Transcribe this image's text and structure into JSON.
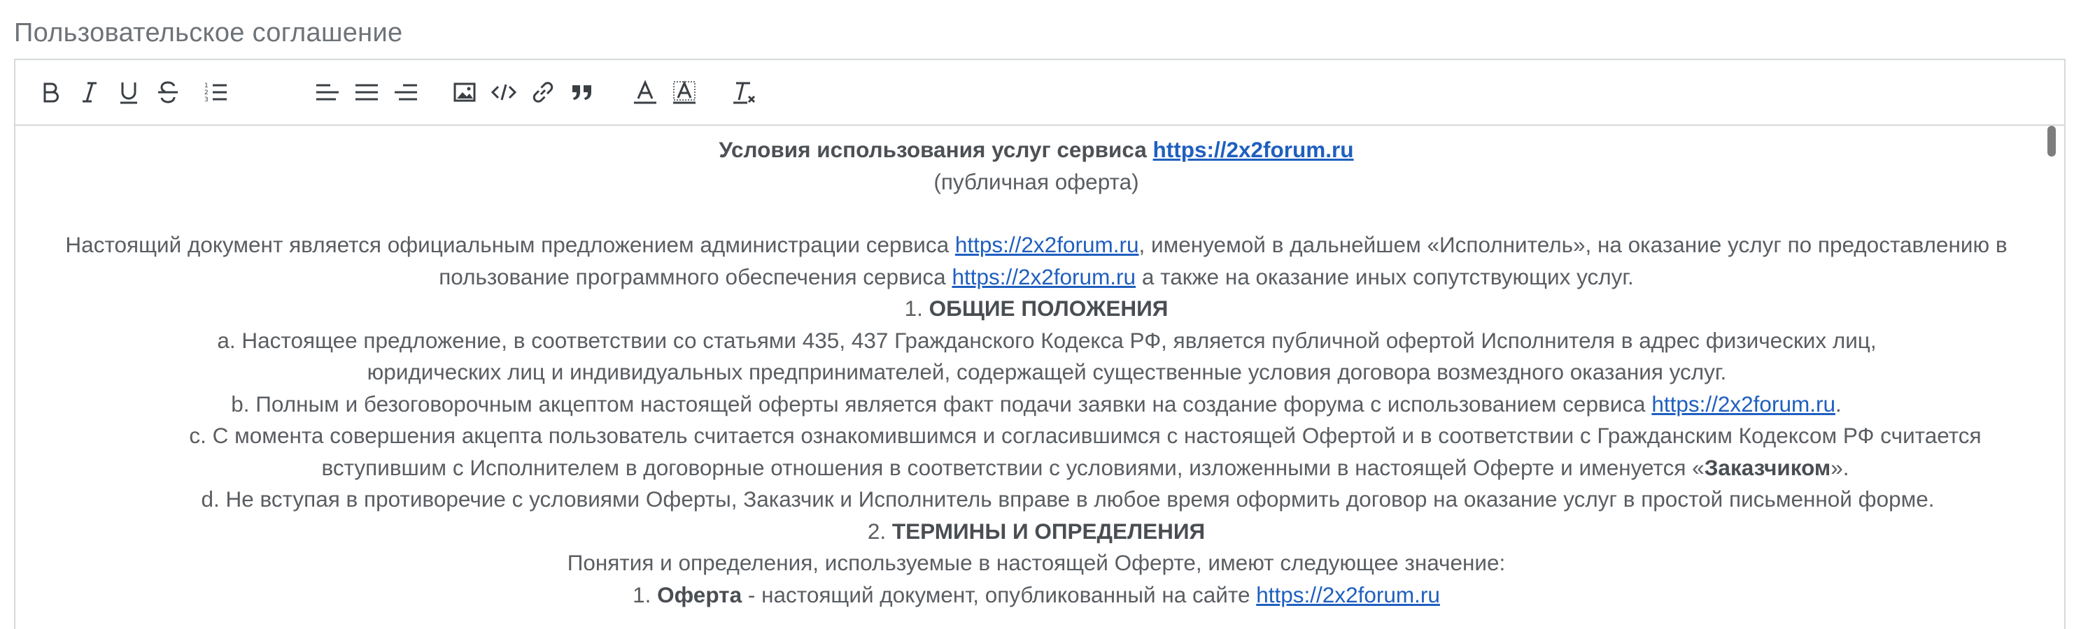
{
  "field": {
    "label": "Пользовательское соглашение"
  },
  "toolbar": {
    "buttons": [
      {
        "name": "bold-button",
        "icon": "bold-icon"
      },
      {
        "name": "italic-button",
        "icon": "italic-icon"
      },
      {
        "name": "underline-button",
        "icon": "underline-icon"
      },
      {
        "name": "strikethrough-button",
        "icon": "strikethrough-icon"
      },
      {
        "name": "ordered-list-button",
        "icon": "ordered-list-icon"
      },
      {
        "name": "align-left-button",
        "icon": "align-left-icon"
      },
      {
        "name": "align-center-button",
        "icon": "align-center-icon"
      },
      {
        "name": "align-right-button",
        "icon": "align-right-icon"
      },
      {
        "name": "insert-image-button",
        "icon": "image-icon"
      },
      {
        "name": "code-button",
        "icon": "code-icon"
      },
      {
        "name": "insert-link-button",
        "icon": "link-icon"
      },
      {
        "name": "blockquote-button",
        "icon": "quote-icon"
      },
      {
        "name": "font-color-button",
        "icon": "font-color-icon"
      },
      {
        "name": "background-color-button",
        "icon": "highlight-icon"
      },
      {
        "name": "clear-format-button",
        "icon": "clear-format-icon"
      }
    ]
  },
  "doc": {
    "link": "https://2x2forum.ru",
    "title": "Условия использования услуг сервиса",
    "subtitle": "(публичная оферта)",
    "intro_1": "Настоящий документ является официальным предложением администрации сервиса",
    "intro_2": ", именуемой в дальнейшем «Исполнитель», на оказание услуг по предоставлению в пользование программного обеспечения сервиса",
    "intro_3": "а также на оказание иных сопутствующих услуг.",
    "s1_num": "1.",
    "s1_title": "ОБЩИЕ ПОЛОЖЕНИЯ",
    "s1_a": "a. Настоящее предложение, в соответствии со статьями 435, 437 Гражданского Кодекса РФ, является публичной офертой Исполнителя в адрес физических лиц, юридических лиц и индивидуальных предпринимателей, содержащей существенные условия договора возмездного оказания услуг.",
    "s1_b": "b. Полным и безоговорочным акцептом настоящей оферты является факт подачи заявки на создание форума с использованием сервиса",
    "s1_b_end": ".",
    "s1_c": "c. С момента совершения акцепта пользователь считается ознакомившимся и согласившимся с настоящей Офертой и в соответствии с Гражданским Кодексом РФ считается вступившим с Исполнителем в договорные отношения в соответствии с условиями, изложенными в настоящей Оферте и именуется «",
    "s1_c_bold": "Заказчиком",
    "s1_c_end": "».",
    "s1_d": "d. Не вступая в противоречие с условиями Оферты, Заказчик и Исполнитель вправе в любое время оформить договор на оказание услуг в простой письменной форме.",
    "s2_num": "2.",
    "s2_title": "ТЕРМИНЫ И ОПРЕДЕЛЕНИЯ",
    "s2_intro": "Понятия и определения, используемые в настоящей Оферте, имеют следующее значение:",
    "t1_num": "1.",
    "t1_term": "Оферта",
    "t1_def": "- настоящий документ, опубликованный на сайте"
  }
}
